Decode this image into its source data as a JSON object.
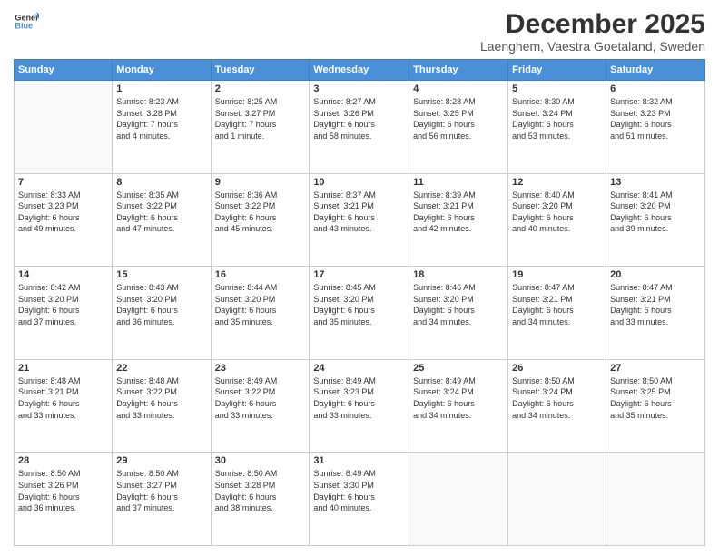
{
  "header": {
    "logo_line1": "General",
    "logo_line2": "Blue",
    "month": "December 2025",
    "location": "Laenghem, Vaestra Goetaland, Sweden"
  },
  "weekdays": [
    "Sunday",
    "Monday",
    "Tuesday",
    "Wednesday",
    "Thursday",
    "Friday",
    "Saturday"
  ],
  "weeks": [
    [
      {
        "day": "",
        "info": ""
      },
      {
        "day": "1",
        "info": "Sunrise: 8:23 AM\nSunset: 3:28 PM\nDaylight: 7 hours\nand 4 minutes."
      },
      {
        "day": "2",
        "info": "Sunrise: 8:25 AM\nSunset: 3:27 PM\nDaylight: 7 hours\nand 1 minute."
      },
      {
        "day": "3",
        "info": "Sunrise: 8:27 AM\nSunset: 3:26 PM\nDaylight: 6 hours\nand 58 minutes."
      },
      {
        "day": "4",
        "info": "Sunrise: 8:28 AM\nSunset: 3:25 PM\nDaylight: 6 hours\nand 56 minutes."
      },
      {
        "day": "5",
        "info": "Sunrise: 8:30 AM\nSunset: 3:24 PM\nDaylight: 6 hours\nand 53 minutes."
      },
      {
        "day": "6",
        "info": "Sunrise: 8:32 AM\nSunset: 3:23 PM\nDaylight: 6 hours\nand 51 minutes."
      }
    ],
    [
      {
        "day": "7",
        "info": "Sunrise: 8:33 AM\nSunset: 3:23 PM\nDaylight: 6 hours\nand 49 minutes."
      },
      {
        "day": "8",
        "info": "Sunrise: 8:35 AM\nSunset: 3:22 PM\nDaylight: 6 hours\nand 47 minutes."
      },
      {
        "day": "9",
        "info": "Sunrise: 8:36 AM\nSunset: 3:22 PM\nDaylight: 6 hours\nand 45 minutes."
      },
      {
        "day": "10",
        "info": "Sunrise: 8:37 AM\nSunset: 3:21 PM\nDaylight: 6 hours\nand 43 minutes."
      },
      {
        "day": "11",
        "info": "Sunrise: 8:39 AM\nSunset: 3:21 PM\nDaylight: 6 hours\nand 42 minutes."
      },
      {
        "day": "12",
        "info": "Sunrise: 8:40 AM\nSunset: 3:20 PM\nDaylight: 6 hours\nand 40 minutes."
      },
      {
        "day": "13",
        "info": "Sunrise: 8:41 AM\nSunset: 3:20 PM\nDaylight: 6 hours\nand 39 minutes."
      }
    ],
    [
      {
        "day": "14",
        "info": "Sunrise: 8:42 AM\nSunset: 3:20 PM\nDaylight: 6 hours\nand 37 minutes."
      },
      {
        "day": "15",
        "info": "Sunrise: 8:43 AM\nSunset: 3:20 PM\nDaylight: 6 hours\nand 36 minutes."
      },
      {
        "day": "16",
        "info": "Sunrise: 8:44 AM\nSunset: 3:20 PM\nDaylight: 6 hours\nand 35 minutes."
      },
      {
        "day": "17",
        "info": "Sunrise: 8:45 AM\nSunset: 3:20 PM\nDaylight: 6 hours\nand 35 minutes."
      },
      {
        "day": "18",
        "info": "Sunrise: 8:46 AM\nSunset: 3:20 PM\nDaylight: 6 hours\nand 34 minutes."
      },
      {
        "day": "19",
        "info": "Sunrise: 8:47 AM\nSunset: 3:21 PM\nDaylight: 6 hours\nand 34 minutes."
      },
      {
        "day": "20",
        "info": "Sunrise: 8:47 AM\nSunset: 3:21 PM\nDaylight: 6 hours\nand 33 minutes."
      }
    ],
    [
      {
        "day": "21",
        "info": "Sunrise: 8:48 AM\nSunset: 3:21 PM\nDaylight: 6 hours\nand 33 minutes."
      },
      {
        "day": "22",
        "info": "Sunrise: 8:48 AM\nSunset: 3:22 PM\nDaylight: 6 hours\nand 33 minutes."
      },
      {
        "day": "23",
        "info": "Sunrise: 8:49 AM\nSunset: 3:22 PM\nDaylight: 6 hours\nand 33 minutes."
      },
      {
        "day": "24",
        "info": "Sunrise: 8:49 AM\nSunset: 3:23 PM\nDaylight: 6 hours\nand 33 minutes."
      },
      {
        "day": "25",
        "info": "Sunrise: 8:49 AM\nSunset: 3:24 PM\nDaylight: 6 hours\nand 34 minutes."
      },
      {
        "day": "26",
        "info": "Sunrise: 8:50 AM\nSunset: 3:24 PM\nDaylight: 6 hours\nand 34 minutes."
      },
      {
        "day": "27",
        "info": "Sunrise: 8:50 AM\nSunset: 3:25 PM\nDaylight: 6 hours\nand 35 minutes."
      }
    ],
    [
      {
        "day": "28",
        "info": "Sunrise: 8:50 AM\nSunset: 3:26 PM\nDaylight: 6 hours\nand 36 minutes."
      },
      {
        "day": "29",
        "info": "Sunrise: 8:50 AM\nSunset: 3:27 PM\nDaylight: 6 hours\nand 37 minutes."
      },
      {
        "day": "30",
        "info": "Sunrise: 8:50 AM\nSunset: 3:28 PM\nDaylight: 6 hours\nand 38 minutes."
      },
      {
        "day": "31",
        "info": "Sunrise: 8:49 AM\nSunset: 3:30 PM\nDaylight: 6 hours\nand 40 minutes."
      },
      {
        "day": "",
        "info": ""
      },
      {
        "day": "",
        "info": ""
      },
      {
        "day": "",
        "info": ""
      }
    ]
  ]
}
